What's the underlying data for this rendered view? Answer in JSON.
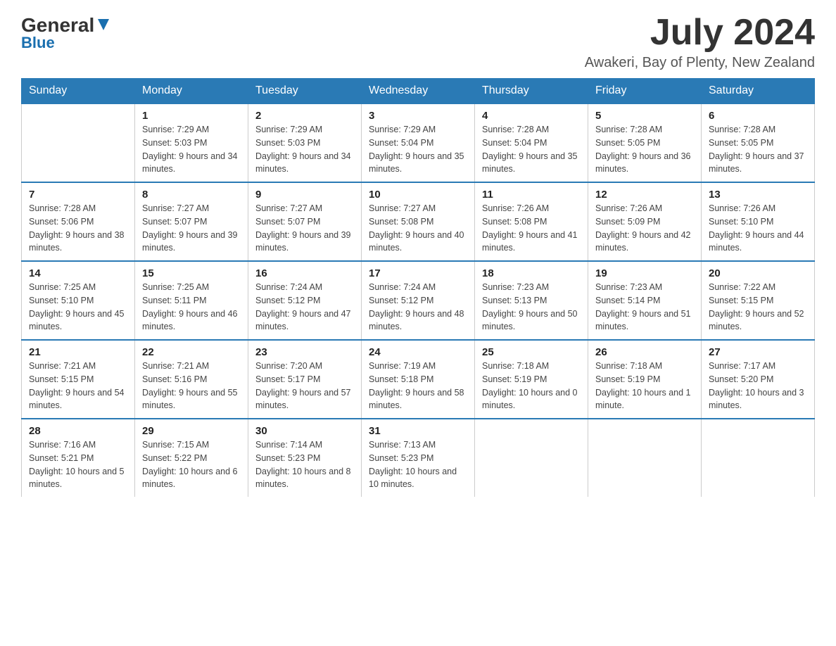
{
  "header": {
    "logo": {
      "general": "General",
      "blue": "Blue",
      "tagline": "Blue"
    },
    "title": "July 2024",
    "location": "Awakeri, Bay of Plenty, New Zealand"
  },
  "days_of_week": [
    "Sunday",
    "Monday",
    "Tuesday",
    "Wednesday",
    "Thursday",
    "Friday",
    "Saturday"
  ],
  "weeks": [
    [
      {
        "day": "",
        "sunrise": "",
        "sunset": "",
        "daylight": ""
      },
      {
        "day": "1",
        "sunrise": "Sunrise: 7:29 AM",
        "sunset": "Sunset: 5:03 PM",
        "daylight": "Daylight: 9 hours and 34 minutes."
      },
      {
        "day": "2",
        "sunrise": "Sunrise: 7:29 AM",
        "sunset": "Sunset: 5:03 PM",
        "daylight": "Daylight: 9 hours and 34 minutes."
      },
      {
        "day": "3",
        "sunrise": "Sunrise: 7:29 AM",
        "sunset": "Sunset: 5:04 PM",
        "daylight": "Daylight: 9 hours and 35 minutes."
      },
      {
        "day": "4",
        "sunrise": "Sunrise: 7:28 AM",
        "sunset": "Sunset: 5:04 PM",
        "daylight": "Daylight: 9 hours and 35 minutes."
      },
      {
        "day": "5",
        "sunrise": "Sunrise: 7:28 AM",
        "sunset": "Sunset: 5:05 PM",
        "daylight": "Daylight: 9 hours and 36 minutes."
      },
      {
        "day": "6",
        "sunrise": "Sunrise: 7:28 AM",
        "sunset": "Sunset: 5:05 PM",
        "daylight": "Daylight: 9 hours and 37 minutes."
      }
    ],
    [
      {
        "day": "7",
        "sunrise": "Sunrise: 7:28 AM",
        "sunset": "Sunset: 5:06 PM",
        "daylight": "Daylight: 9 hours and 38 minutes."
      },
      {
        "day": "8",
        "sunrise": "Sunrise: 7:27 AM",
        "sunset": "Sunset: 5:07 PM",
        "daylight": "Daylight: 9 hours and 39 minutes."
      },
      {
        "day": "9",
        "sunrise": "Sunrise: 7:27 AM",
        "sunset": "Sunset: 5:07 PM",
        "daylight": "Daylight: 9 hours and 39 minutes."
      },
      {
        "day": "10",
        "sunrise": "Sunrise: 7:27 AM",
        "sunset": "Sunset: 5:08 PM",
        "daylight": "Daylight: 9 hours and 40 minutes."
      },
      {
        "day": "11",
        "sunrise": "Sunrise: 7:26 AM",
        "sunset": "Sunset: 5:08 PM",
        "daylight": "Daylight: 9 hours and 41 minutes."
      },
      {
        "day": "12",
        "sunrise": "Sunrise: 7:26 AM",
        "sunset": "Sunset: 5:09 PM",
        "daylight": "Daylight: 9 hours and 42 minutes."
      },
      {
        "day": "13",
        "sunrise": "Sunrise: 7:26 AM",
        "sunset": "Sunset: 5:10 PM",
        "daylight": "Daylight: 9 hours and 44 minutes."
      }
    ],
    [
      {
        "day": "14",
        "sunrise": "Sunrise: 7:25 AM",
        "sunset": "Sunset: 5:10 PM",
        "daylight": "Daylight: 9 hours and 45 minutes."
      },
      {
        "day": "15",
        "sunrise": "Sunrise: 7:25 AM",
        "sunset": "Sunset: 5:11 PM",
        "daylight": "Daylight: 9 hours and 46 minutes."
      },
      {
        "day": "16",
        "sunrise": "Sunrise: 7:24 AM",
        "sunset": "Sunset: 5:12 PM",
        "daylight": "Daylight: 9 hours and 47 minutes."
      },
      {
        "day": "17",
        "sunrise": "Sunrise: 7:24 AM",
        "sunset": "Sunset: 5:12 PM",
        "daylight": "Daylight: 9 hours and 48 minutes."
      },
      {
        "day": "18",
        "sunrise": "Sunrise: 7:23 AM",
        "sunset": "Sunset: 5:13 PM",
        "daylight": "Daylight: 9 hours and 50 minutes."
      },
      {
        "day": "19",
        "sunrise": "Sunrise: 7:23 AM",
        "sunset": "Sunset: 5:14 PM",
        "daylight": "Daylight: 9 hours and 51 minutes."
      },
      {
        "day": "20",
        "sunrise": "Sunrise: 7:22 AM",
        "sunset": "Sunset: 5:15 PM",
        "daylight": "Daylight: 9 hours and 52 minutes."
      }
    ],
    [
      {
        "day": "21",
        "sunrise": "Sunrise: 7:21 AM",
        "sunset": "Sunset: 5:15 PM",
        "daylight": "Daylight: 9 hours and 54 minutes."
      },
      {
        "day": "22",
        "sunrise": "Sunrise: 7:21 AM",
        "sunset": "Sunset: 5:16 PM",
        "daylight": "Daylight: 9 hours and 55 minutes."
      },
      {
        "day": "23",
        "sunrise": "Sunrise: 7:20 AM",
        "sunset": "Sunset: 5:17 PM",
        "daylight": "Daylight: 9 hours and 57 minutes."
      },
      {
        "day": "24",
        "sunrise": "Sunrise: 7:19 AM",
        "sunset": "Sunset: 5:18 PM",
        "daylight": "Daylight: 9 hours and 58 minutes."
      },
      {
        "day": "25",
        "sunrise": "Sunrise: 7:18 AM",
        "sunset": "Sunset: 5:19 PM",
        "daylight": "Daylight: 10 hours and 0 minutes."
      },
      {
        "day": "26",
        "sunrise": "Sunrise: 7:18 AM",
        "sunset": "Sunset: 5:19 PM",
        "daylight": "Daylight: 10 hours and 1 minute."
      },
      {
        "day": "27",
        "sunrise": "Sunrise: 7:17 AM",
        "sunset": "Sunset: 5:20 PM",
        "daylight": "Daylight: 10 hours and 3 minutes."
      }
    ],
    [
      {
        "day": "28",
        "sunrise": "Sunrise: 7:16 AM",
        "sunset": "Sunset: 5:21 PM",
        "daylight": "Daylight: 10 hours and 5 minutes."
      },
      {
        "day": "29",
        "sunrise": "Sunrise: 7:15 AM",
        "sunset": "Sunset: 5:22 PM",
        "daylight": "Daylight: 10 hours and 6 minutes."
      },
      {
        "day": "30",
        "sunrise": "Sunrise: 7:14 AM",
        "sunset": "Sunset: 5:23 PM",
        "daylight": "Daylight: 10 hours and 8 minutes."
      },
      {
        "day": "31",
        "sunrise": "Sunrise: 7:13 AM",
        "sunset": "Sunset: 5:23 PM",
        "daylight": "Daylight: 10 hours and 10 minutes."
      },
      {
        "day": "",
        "sunrise": "",
        "sunset": "",
        "daylight": ""
      },
      {
        "day": "",
        "sunrise": "",
        "sunset": "",
        "daylight": ""
      },
      {
        "day": "",
        "sunrise": "",
        "sunset": "",
        "daylight": ""
      }
    ]
  ]
}
